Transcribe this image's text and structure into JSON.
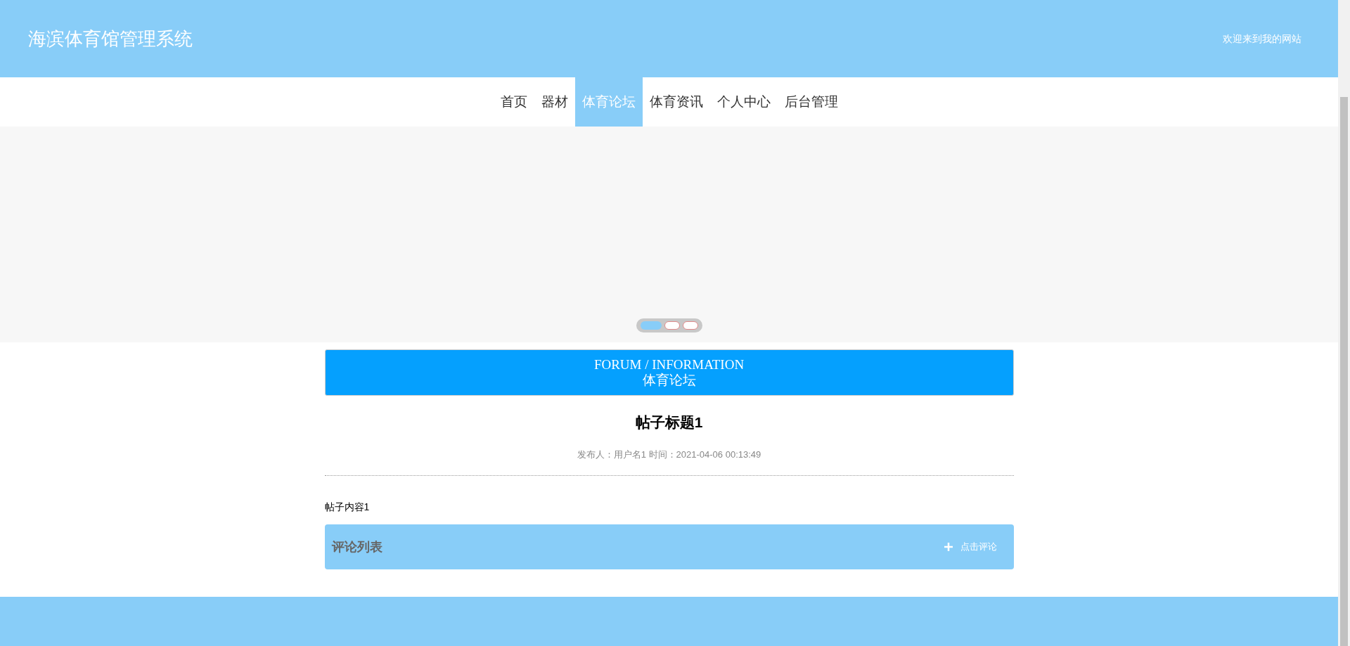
{
  "header": {
    "title": "海滨体育馆管理系统",
    "welcome": "欢迎来到我的网站"
  },
  "nav": [
    {
      "label": "首页",
      "selected": false
    },
    {
      "label": "器材",
      "selected": false
    },
    {
      "label": "体育论坛",
      "selected": true
    },
    {
      "label": "体育资讯",
      "selected": false
    },
    {
      "label": "个人中心",
      "selected": false
    },
    {
      "label": "后台管理",
      "selected": false
    }
  ],
  "carousel": {
    "dots": [
      {
        "selected": true
      },
      {
        "selected": false
      },
      {
        "selected": false
      }
    ]
  },
  "banner": {
    "title": "FORUM / INFORMATION",
    "subtitle": "体育论坛"
  },
  "post": {
    "title": "帖子标题1",
    "meta": "发布人：用户名1 时间：2021-04-06 00:13:49",
    "content": "帖子内容1"
  },
  "comments": {
    "title": "评论列表",
    "add_label": "点击评论"
  }
}
